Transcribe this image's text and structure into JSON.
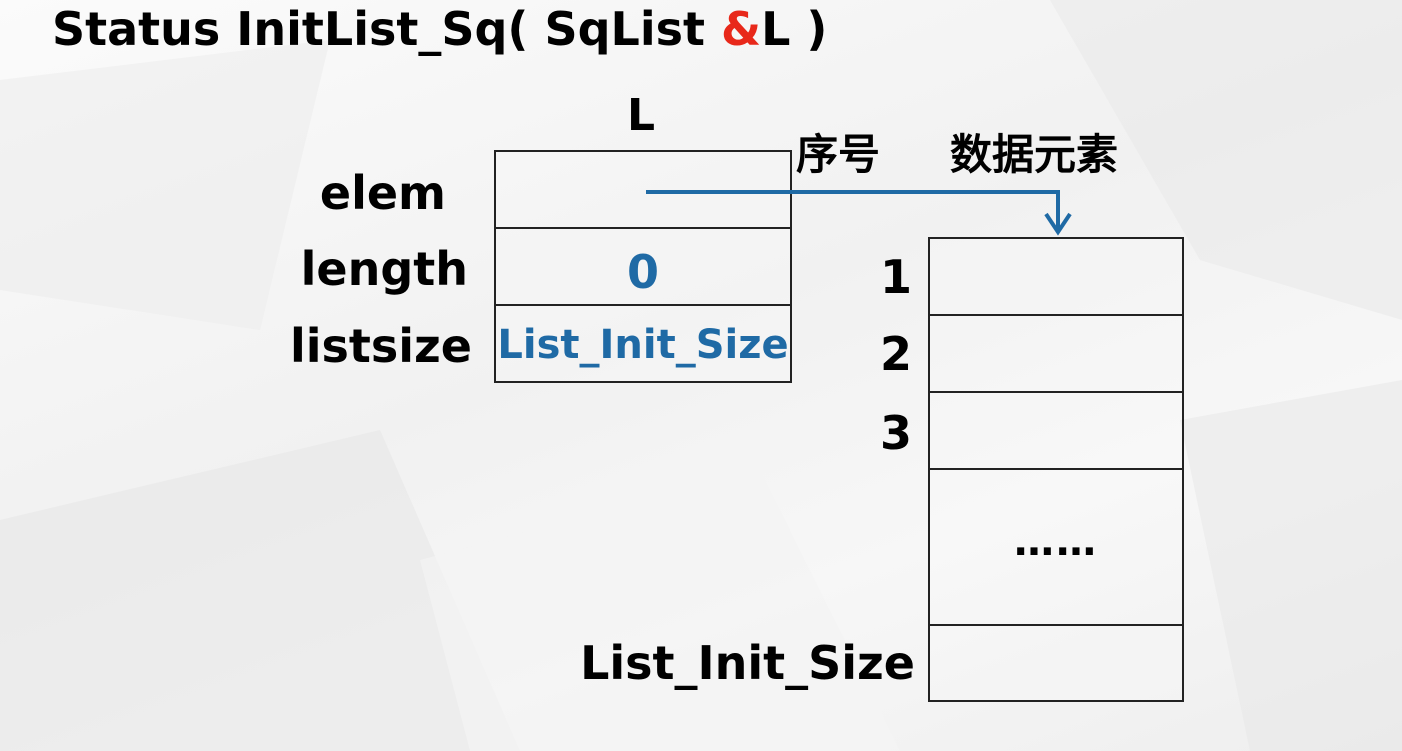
{
  "title": {
    "prefix": "Status  InitList_Sq( SqList ",
    "ampersand": "&",
    "suffix": "L )"
  },
  "struct": {
    "name": "L",
    "fields": [
      {
        "label": "elem",
        "value": ""
      },
      {
        "label": "length",
        "value": "0"
      },
      {
        "label": "listsize",
        "value": "List_Init_Size"
      }
    ]
  },
  "array": {
    "index_header": "序号",
    "element_header": "数据元素",
    "rows": [
      {
        "index": "1",
        "content": ""
      },
      {
        "index": "2",
        "content": ""
      },
      {
        "index": "3",
        "content": ""
      },
      {
        "index": "",
        "content": "……"
      },
      {
        "index": "List_Init_Size",
        "content": ""
      }
    ]
  },
  "colors": {
    "pointer": "#1f6aa5",
    "value_text": "#1f6aa5",
    "ampersand": "#e8281a"
  }
}
